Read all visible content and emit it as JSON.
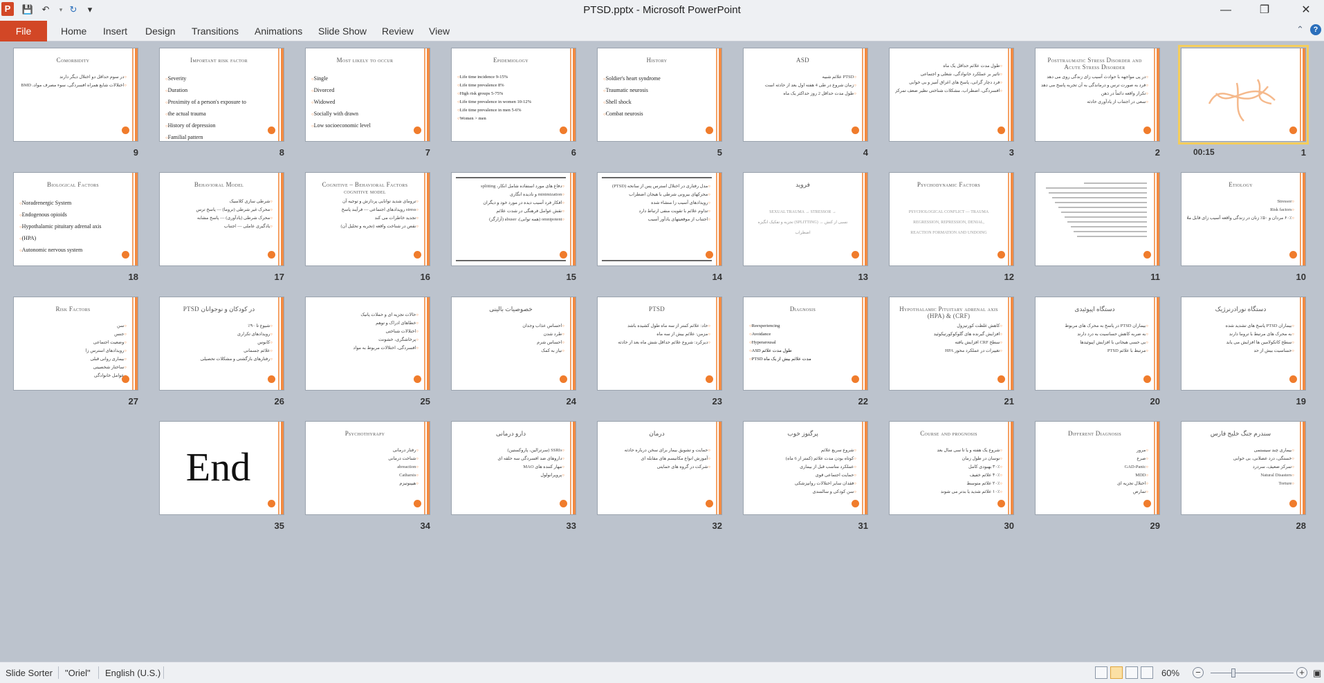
{
  "window": {
    "title": "PTSD.pptx - Microsoft PowerPoint",
    "app_icon": "P",
    "quick_access": [
      "save-icon",
      "undo-icon",
      "redo-icon",
      "customize-icon"
    ],
    "controls": [
      "minimize-icon",
      "restore-icon",
      "close-icon"
    ]
  },
  "ribbon": {
    "file_label": "File",
    "tabs": [
      "Home",
      "Insert",
      "Design",
      "Transitions",
      "Animations",
      "Slide Show",
      "Review",
      "View"
    ],
    "right_icons": [
      "minimize-ribbon-icon",
      "help-icon"
    ]
  },
  "sorter": {
    "timing_label": "00:15",
    "slides": [
      {
        "n": "1",
        "kind": "callig"
      },
      {
        "n": "2",
        "title": "Posttraumatic Stress Disorder and Acute Stress Disorder",
        "rtl": true,
        "lines": [
          "در پی مواجهه با حوادث آسیب زای زندگی روی می دهد",
          "فرد به صورت ترس و درماندگی به آن تجربه پاسخ می دهد",
          "تکرار واقعه دائماً در ذهن",
          "سعی در اجتناب از یادآوری حادثه"
        ]
      },
      {
        "n": "3",
        "title": "",
        "rtl": true,
        "lines": [
          "طول مدت علائم حداقل یک ماه",
          "تاثیر بر عملکرد خانوادگی، شغلی و اجتماعی",
          "فرد دچار گرانی، پاسخ های اغراق آمیز و بی خوابی",
          "افسردگی، اضطراب، مشکلات شناختی نظیر ضعف تمرکز"
        ]
      },
      {
        "n": "4",
        "title": "ASD",
        "rtl": true,
        "lines": [
          "PTSD علائم شبیه",
          "زمان شروع در طی 4 هفته اول بعد از حادثه است",
          "طول مدت حداقل 2 روز حداکثر یک ماه"
        ]
      },
      {
        "n": "5",
        "title": "History",
        "rtl": false,
        "lines": [
          "Soldier's heart syndrome",
          "Traumatic neurosis",
          "Shell shock",
          "Combat neurosis"
        ]
      },
      {
        "n": "6",
        "title": "Epidemiology",
        "rtl": false,
        "small": true,
        "lines": [
          "Life time incidence          9-15%",
          "Life time prevalence          8%",
          "High risk groups              5-75%",
          "Life time prevalence in women  10-12%",
          "Life time prevalence in men   5-6%",
          "Women > men"
        ]
      },
      {
        "n": "7",
        "title": "Most likely to occur",
        "rtl": false,
        "lines": [
          "Single",
          "Divorced",
          "Widowed",
          "Socially with drawn",
          "Low socioeconomic level"
        ]
      },
      {
        "n": "8",
        "title": "Important risk factor",
        "rtl": false,
        "lines": [
          "Severity",
          "Duration",
          "Proximity of a person's exposure to",
          "the actual trauma",
          "History of depression",
          "Familial pattern"
        ]
      },
      {
        "n": "9",
        "title": "Comorbidity",
        "rtl": true,
        "lines": [
          "در سوم حداقل دو اختلال دیگر دارند",
          "اختلالات شایع همراه افسردگی، سوء مصرف مواد، BMD"
        ]
      },
      {
        "n": "10",
        "title": "Etiology",
        "rtl": true,
        "lines": [
          "Stressor",
          "Risk factors",
          "۶۰٪ مردان و ۵۰٪ زنان در زندگی واقعه آسیب زای قابل ملاحظه ای را تجربه کرده اند"
        ]
      },
      {
        "n": "11",
        "kind": "lines"
      },
      {
        "n": "12",
        "title": "Psychodynamic Factors",
        "rtl": false,
        "centered": true,
        "lines": [
          "PSYCHOLOGICAL CONFLICT — TRAUMA",
          "REGRESSION, REPRESSION, DENIAL,",
          "REACTION FORMATION AND UNDOING"
        ]
      },
      {
        "n": "13",
        "title": "فروید",
        "rtl": false,
        "centered": true,
        "lines": [
          "SEXUAL TRAUMA → STRESSOR →",
          "تجزیه و تفکیک انگیزه (SPLITTING) → نسبی از کنش",
          "اضطراب"
        ]
      },
      {
        "n": "14",
        "kind": "rtltext",
        "lines": [
          "مدل رفتاری در اختلال استرس پس از سانحه (PTSD)",
          "محرکهای بیرونی شرطی با هیجان اضطراب",
          "رویدادهای آسیب زا منشاء شده",
          "تداوم علائم با تقویت منفی ارتباط دارد",
          "اجتناب از موقعیتهای یادآور آسیب"
        ]
      },
      {
        "n": "15",
        "kind": "rtltext",
        "lines": [
          "دفاع های مورد استفاده شامل انکار، splitting",
          "minimization و نادیده انگاری",
          "افکار فرد آسیب دیده در مورد خود و دیگران",
          "نقش عوامل فرهنگی در شدت علائم",
          "omnipotent (همه توانی)، abuser (آزارگر)"
        ]
      },
      {
        "n": "16",
        "title": "Cognitive – Behavioral Factors cognitive model",
        "rtl": true,
        "lines": [
          "ترومای شدید توانایی پردازش و توجیه آن",
          "stress رویدادهای اجتماعی — فرآیند پاسخ",
          "تجدید خاطرات می کند",
          "نقص در شناخت واقعه (تجربه و تحلیل آن)"
        ]
      },
      {
        "n": "17",
        "title": "Behavioral Model",
        "rtl": true,
        "lines": [
          "شرطی سازی کلاسیک",
          "محرک غیر شرطی (تروما) — پاسخ ترس",
          "محرک شرطی (یادآوری) — پاسخ مشابه",
          "یادگیری عاملی — اجتناب"
        ]
      },
      {
        "n": "18",
        "title": "Biological Factors",
        "rtl": false,
        "lines": [
          "Noradrenergic System",
          "Endogenous opioids",
          "Hypothalamic pituitary adrenal axis",
          "(HPA)",
          "Autonomic nervous system"
        ]
      },
      {
        "n": "19",
        "title": "دستگاه نورادرنرژیک",
        "rtl": true,
        "lines": [
          "بیماران PTSD پاسخ های تشدید شده",
          "به محرک های مرتبط با تروما دارند",
          "سطح کاتکولامین ها افزایش می یابد",
          "حساسیت بیش از حد"
        ]
      },
      {
        "n": "20",
        "title": "دستگاه اپیوئیدی",
        "rtl": true,
        "lines": [
          "بیماران PTSD در پاسخ به محرک های مربوط",
          "به ضربه کاهش حساسیت به درد دارند",
          "بی حسی هیجانی با افزایش اپیوئیدها",
          "مرتبط با علائم PTSD"
        ]
      },
      {
        "n": "21",
        "title": "Hypothalamic Pituitary adrenal axis (HPA) & (CRF)",
        "rtl": true,
        "lines": [
          "کاهش غلظت کورتیزول",
          "افزایش گیرنده های گلوکوکورتیکوئید",
          "سطح CRF افزایش یافته",
          "تغییرات در عملکرد محور HPA"
        ]
      },
      {
        "n": "22",
        "title": "Diagnosis",
        "rtl": false,
        "small": true,
        "lines": [
          "Reexperiencing",
          "Avoidance",
          "Hyperarousal",
          "ASD طول مدت علائم",
          "PTSD مدت علائم بیش از یک ماه"
        ]
      },
      {
        "n": "23",
        "title": "PTSD",
        "rtl": true,
        "lines": [
          "حاد: علائم کمتر از سه ماه طول کشیده باشد",
          "مزمن: علائم بیش از سه ماه",
          "دیرکرد: شروع علائم حداقل شش ماه بعد از حادثه"
        ]
      },
      {
        "n": "24",
        "title": "خصوصیات بالینی",
        "rtl": true,
        "lines": [
          "احساس عذاب وجدان",
          "طرد شدن",
          "احساس شرم",
          "نیاز به کمک"
        ]
      },
      {
        "n": "25",
        "title": "",
        "rtl": true,
        "lines": [
          "حالات تجزیه ای و حملات پانیک",
          "خطاهای ادراک و توهم",
          "اختلالات شناختی",
          "پرخاشگری، خشونت",
          "افسردگی، اختلالات مربوط به مواد"
        ]
      },
      {
        "n": "26",
        "title": "PTSD در کودکان و نوجوانان",
        "rtl": true,
        "lines": [
          "شیوع تا ۹۰٪",
          "رویدادهای تکراری",
          "کابوس",
          "علائم جسمانی",
          "رفتارهای بازگشتی و مشکلات تحصیلی"
        ]
      },
      {
        "n": "27",
        "title": "Risk Factors",
        "rtl": true,
        "lines": [
          "سن",
          "جنس",
          "وضعیت اجتماعی",
          "رویدادهای استرس زا",
          "بیماری روانی قبلی",
          "ساختار شخصیتی",
          "عوامل خانوادگی"
        ]
      },
      {
        "n": "28",
        "title": "سندرم جنگ خلیج فارس",
        "rtl": true,
        "lines": [
          "بیماری چند سیستمی",
          "خستگی، درد عضلانی، بی خوابی",
          "تمرکز ضعیف، سردرد",
          "Natural Disasters",
          "Torture"
        ]
      },
      {
        "n": "29",
        "title": "Different Diagnosis",
        "rtl": true,
        "lines": [
          "مرور",
          "صرع",
          "GAD-Panic",
          "MDD",
          "اختلال تجزیه ای",
          "تمارض"
        ]
      },
      {
        "n": "30",
        "title": "Course and prognosis",
        "rtl": true,
        "lines": [
          "شروع یک هفته و یا تا سی سال بعد",
          "نوسان در طول زمان",
          "۳۰٪ بهبودی کامل",
          "۴۰٪ علائم خفیف",
          "۲۰٪ علائم متوسط",
          "۱۰٪ علائم شدید یا بدتر می شوند"
        ]
      },
      {
        "n": "31",
        "title": "پرگنوز خوب",
        "rtl": true,
        "lines": [
          "شروع سریع علائم",
          "کوتاه بودن مدت علائم (کمتر از 6 ماه)",
          "عملکرد مناسب قبل از بیماری",
          "حمایت اجتماعی قوی",
          "فقدان سایر اختلالات روانپزشکی",
          "سن کودکی و سالمندی"
        ]
      },
      {
        "n": "32",
        "title": "درمان",
        "rtl": true,
        "lines": [
          "حمایت و تشویق بیمار برای سخن درباره حادثه",
          "آموزش انواع مکانیسم های مقابله ای",
          "شرکت در گروه های حمایتی"
        ]
      },
      {
        "n": "33",
        "title": "دارو درمانی",
        "rtl": true,
        "lines": [
          "SSRIs (سرترالین، پاروکستین)",
          "داروهای ضد افسردگی سه حلقه ای",
          "مهار کننده های MAO",
          "پروپرانولول"
        ]
      },
      {
        "n": "34",
        "title": "Psychothyrapy",
        "rtl": true,
        "lines": [
          "رفتار درمانی",
          "شناخت درمانی",
          "abreaction",
          "Catharsis",
          "هیپنوتیزم"
        ]
      },
      {
        "n": "35",
        "kind": "end",
        "text": "End"
      }
    ]
  },
  "status": {
    "slide_sorter": "Slide Sorter",
    "theme": "\"Oriel\"",
    "language": "English (U.S.)",
    "zoom": "60%",
    "zoom_value": 60,
    "view_buttons": [
      "normal-view-icon",
      "slide-sorter-view-icon",
      "reading-view-icon",
      "slideshow-view-icon"
    ],
    "active_view": 1
  },
  "colors": {
    "accent": "#f07c2c",
    "file_tab": "#d24726",
    "selection": "#f4cd5b",
    "background": "#bcc3cd"
  }
}
